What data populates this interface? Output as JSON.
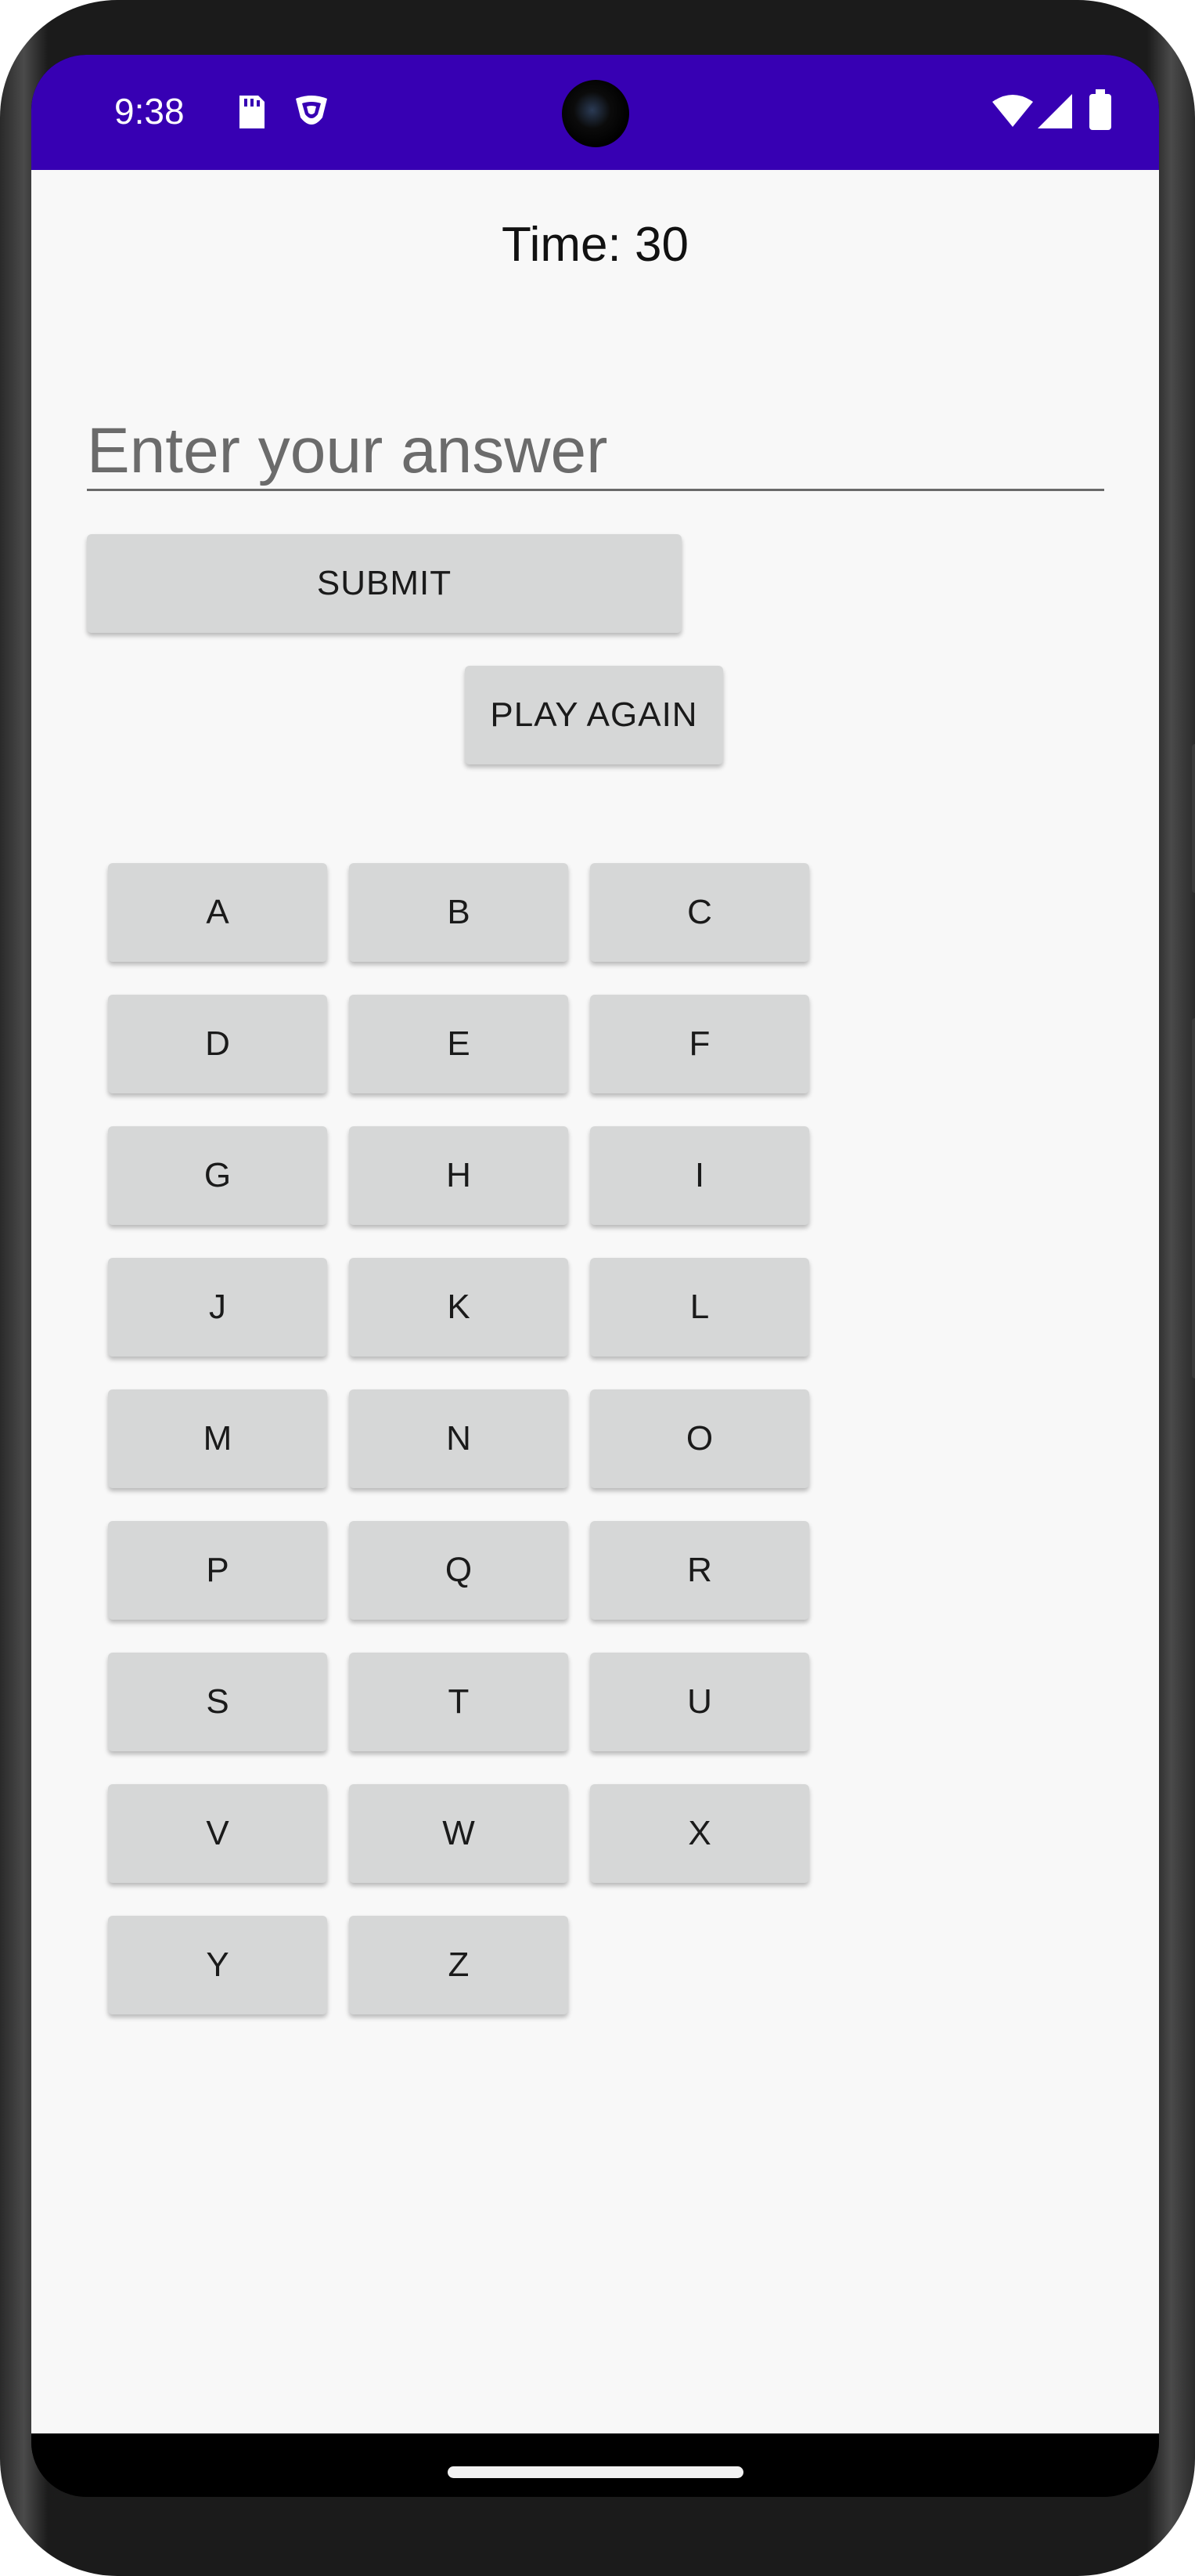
{
  "theme": {
    "accent": "#3700b3",
    "app_background": "#f8f8f8",
    "button_background": "#d6d7d7"
  },
  "status_bar": {
    "time": "9:38",
    "left_icons": [
      "sd-card-icon",
      "shield-icon"
    ],
    "right_icons": [
      "wifi-icon",
      "cellular-signal-icon",
      "battery-icon"
    ]
  },
  "game": {
    "timer_text": "Time: 30",
    "answer_input": {
      "value": "",
      "placeholder": "Enter your answer"
    },
    "submit_label": "SUBMIT",
    "play_again_label": "PLAY AGAIN",
    "letters": [
      "A",
      "B",
      "C",
      "D",
      "E",
      "F",
      "G",
      "H",
      "I",
      "J",
      "K",
      "L",
      "M",
      "N",
      "O",
      "P",
      "Q",
      "R",
      "S",
      "T",
      "U",
      "V",
      "W",
      "X",
      "Y",
      "Z"
    ]
  },
  "navigation": {
    "home_indicator": "home-indicator"
  }
}
